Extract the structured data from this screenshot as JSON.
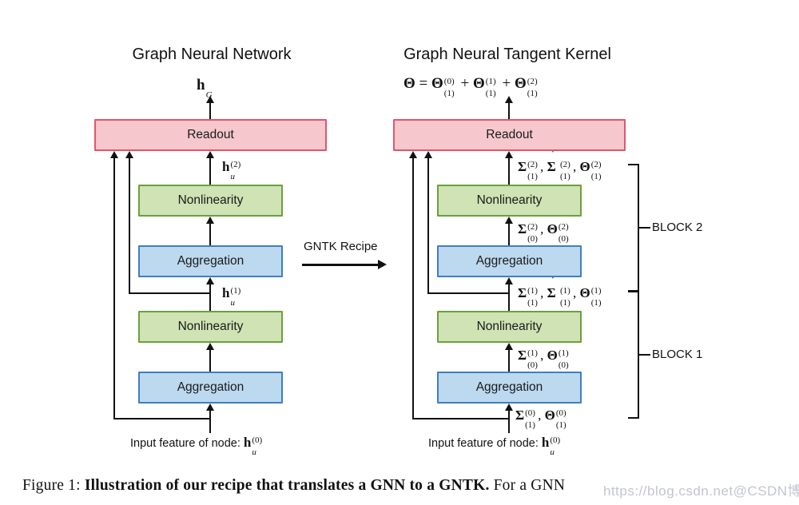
{
  "figure": {
    "panels": [
      {
        "id": "gnn",
        "title": "Graph Neural Network"
      },
      {
        "id": "gntk",
        "title": "Graph Neural Tangent Kernel"
      }
    ],
    "transform_arrow": {
      "label": "GNTK Recipe"
    },
    "boxes": {
      "readout": "Readout",
      "nonlinearity": "Nonlinearity",
      "aggregation": "Aggregation"
    },
    "gnn_panel": {
      "output_label": {
        "base": "h",
        "sup": "",
        "sub": "G"
      },
      "edge_labels": [
        {
          "base": "h",
          "sup": "(2)",
          "sub": "u"
        },
        {
          "base": "h",
          "sup": "(1)",
          "sub": "u"
        }
      ],
      "input_label": {
        "text": "Input feature of node:",
        "base": "h",
        "sup": "(0)",
        "sub": "u"
      },
      "box_sequence": [
        "Readout",
        "Nonlinearity",
        "Aggregation",
        "Nonlinearity",
        "Aggregation"
      ]
    },
    "gntk_panel": {
      "output_formula": {
        "lhs": "Θ",
        "eq": "=",
        "terms": [
          {
            "base": "Θ",
            "sup": "(0)",
            "sub": "(1)"
          },
          {
            "base": "Θ",
            "sup": "(1)",
            "sub": "(1)"
          },
          {
            "base": "Θ",
            "sup": "(2)",
            "sub": "(1)"
          }
        ],
        "operator": "+"
      },
      "edge_labels": [
        {
          "id": "above-nonlinearity-2",
          "terms": [
            {
              "base": "Σ",
              "sup": "(2)",
              "sub": "(1)",
              "dot": false
            },
            {
              "base": "Σ",
              "sup": "(2)",
              "sub": "(1)",
              "dot": true
            },
            {
              "base": "Θ",
              "sup": "(2)",
              "sub": "(1)",
              "dot": false
            }
          ]
        },
        {
          "id": "above-aggregation-2",
          "terms": [
            {
              "base": "Σ",
              "sup": "(2)",
              "sub": "(0)",
              "dot": false
            },
            {
              "base": "Θ",
              "sup": "(2)",
              "sub": "(0)",
              "dot": false
            }
          ]
        },
        {
          "id": "above-nonlinearity-1",
          "terms": [
            {
              "base": "Σ",
              "sup": "(1)",
              "sub": "(1)",
              "dot": false
            },
            {
              "base": "Σ",
              "sup": "(1)",
              "sub": "(1)",
              "dot": true
            },
            {
              "base": "Θ",
              "sup": "(1)",
              "sub": "(1)",
              "dot": false
            }
          ]
        },
        {
          "id": "above-aggregation-1",
          "terms": [
            {
              "base": "Σ",
              "sup": "(1)",
              "sub": "(0)",
              "dot": false
            },
            {
              "base": "Θ",
              "sup": "(1)",
              "sub": "(0)",
              "dot": false
            }
          ]
        },
        {
          "id": "input-level",
          "terms": [
            {
              "base": "Σ",
              "sup": "(0)",
              "sub": "(1)",
              "dot": false
            },
            {
              "base": "Θ",
              "sup": "(0)",
              "sub": "(1)",
              "dot": false
            }
          ]
        }
      ],
      "input_label": {
        "text": "Input feature of node:",
        "base": "h",
        "sup": "(0)",
        "sub": "u"
      },
      "block_labels": [
        {
          "id": "block-2",
          "label": "BLOCK 2"
        },
        {
          "id": "block-1",
          "label": "BLOCK 1"
        }
      ]
    },
    "colors": {
      "readout_fill": "#f6c7cd",
      "readout_border": "#e0566e",
      "nonlinearity_fill": "#cfe3b4",
      "nonlinearity_border": "#6aa13c",
      "aggregation_fill": "#bcd9f0",
      "aggregation_border": "#3f7fbf",
      "connector": "#111111",
      "background": "#ffffff"
    }
  },
  "caption": {
    "number": "Figure 1:",
    "bold_part": "Illustration of our recipe that translates a GNN to a GNTK.",
    "tail": "For a GNN"
  },
  "watermark": {
    "text": "https://blog.csdn.net@CSDN博客"
  }
}
